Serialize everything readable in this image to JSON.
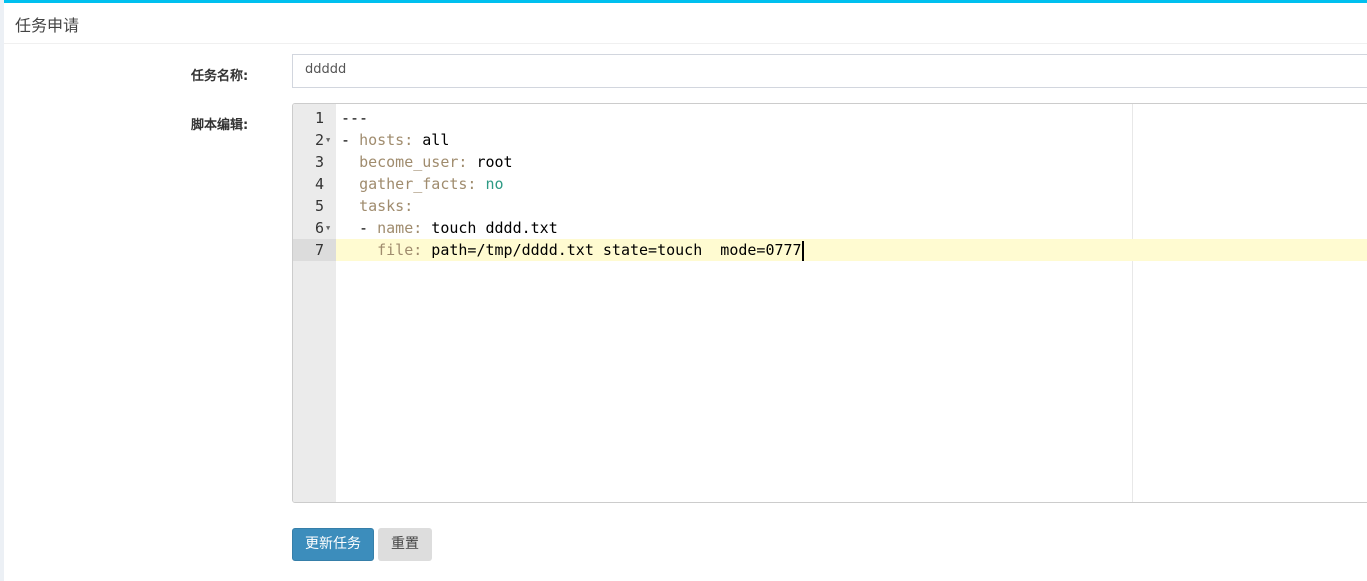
{
  "header": {
    "title": "任务申请"
  },
  "form": {
    "name_label": "任务名称:",
    "name_value": "ddddd",
    "script_label": "脚本编辑:"
  },
  "editor": {
    "active_line": 7,
    "lines": [
      {
        "n": "1",
        "fold": false,
        "tokens": [
          {
            "t": "---",
            "c": "v"
          }
        ]
      },
      {
        "n": "2",
        "fold": true,
        "tokens": [
          {
            "t": "- ",
            "c": "v"
          },
          {
            "t": "hosts:",
            "c": "k"
          },
          {
            "t": " all",
            "c": "v"
          }
        ]
      },
      {
        "n": "3",
        "fold": false,
        "tokens": [
          {
            "t": "  ",
            "c": "v"
          },
          {
            "t": "become_user:",
            "c": "k"
          },
          {
            "t": " root",
            "c": "v"
          }
        ]
      },
      {
        "n": "4",
        "fold": false,
        "tokens": [
          {
            "t": "  ",
            "c": "v"
          },
          {
            "t": "gather_facts:",
            "c": "k"
          },
          {
            "t": " no",
            "c": "b"
          }
        ]
      },
      {
        "n": "5",
        "fold": false,
        "tokens": [
          {
            "t": "  ",
            "c": "v"
          },
          {
            "t": "tasks:",
            "c": "k"
          }
        ]
      },
      {
        "n": "6",
        "fold": true,
        "tokens": [
          {
            "t": "  - ",
            "c": "v"
          },
          {
            "t": "name:",
            "c": "k"
          },
          {
            "t": " touch dddd.txt",
            "c": "v"
          }
        ]
      },
      {
        "n": "7",
        "fold": false,
        "tokens": [
          {
            "t": "    ",
            "c": "v"
          },
          {
            "t": "file:",
            "c": "k"
          },
          {
            "t": " path=/tmp/dddd.txt state=touch  mode=0777",
            "c": "v"
          }
        ]
      }
    ]
  },
  "buttons": {
    "update": "更新任务",
    "reset": "重置"
  }
}
